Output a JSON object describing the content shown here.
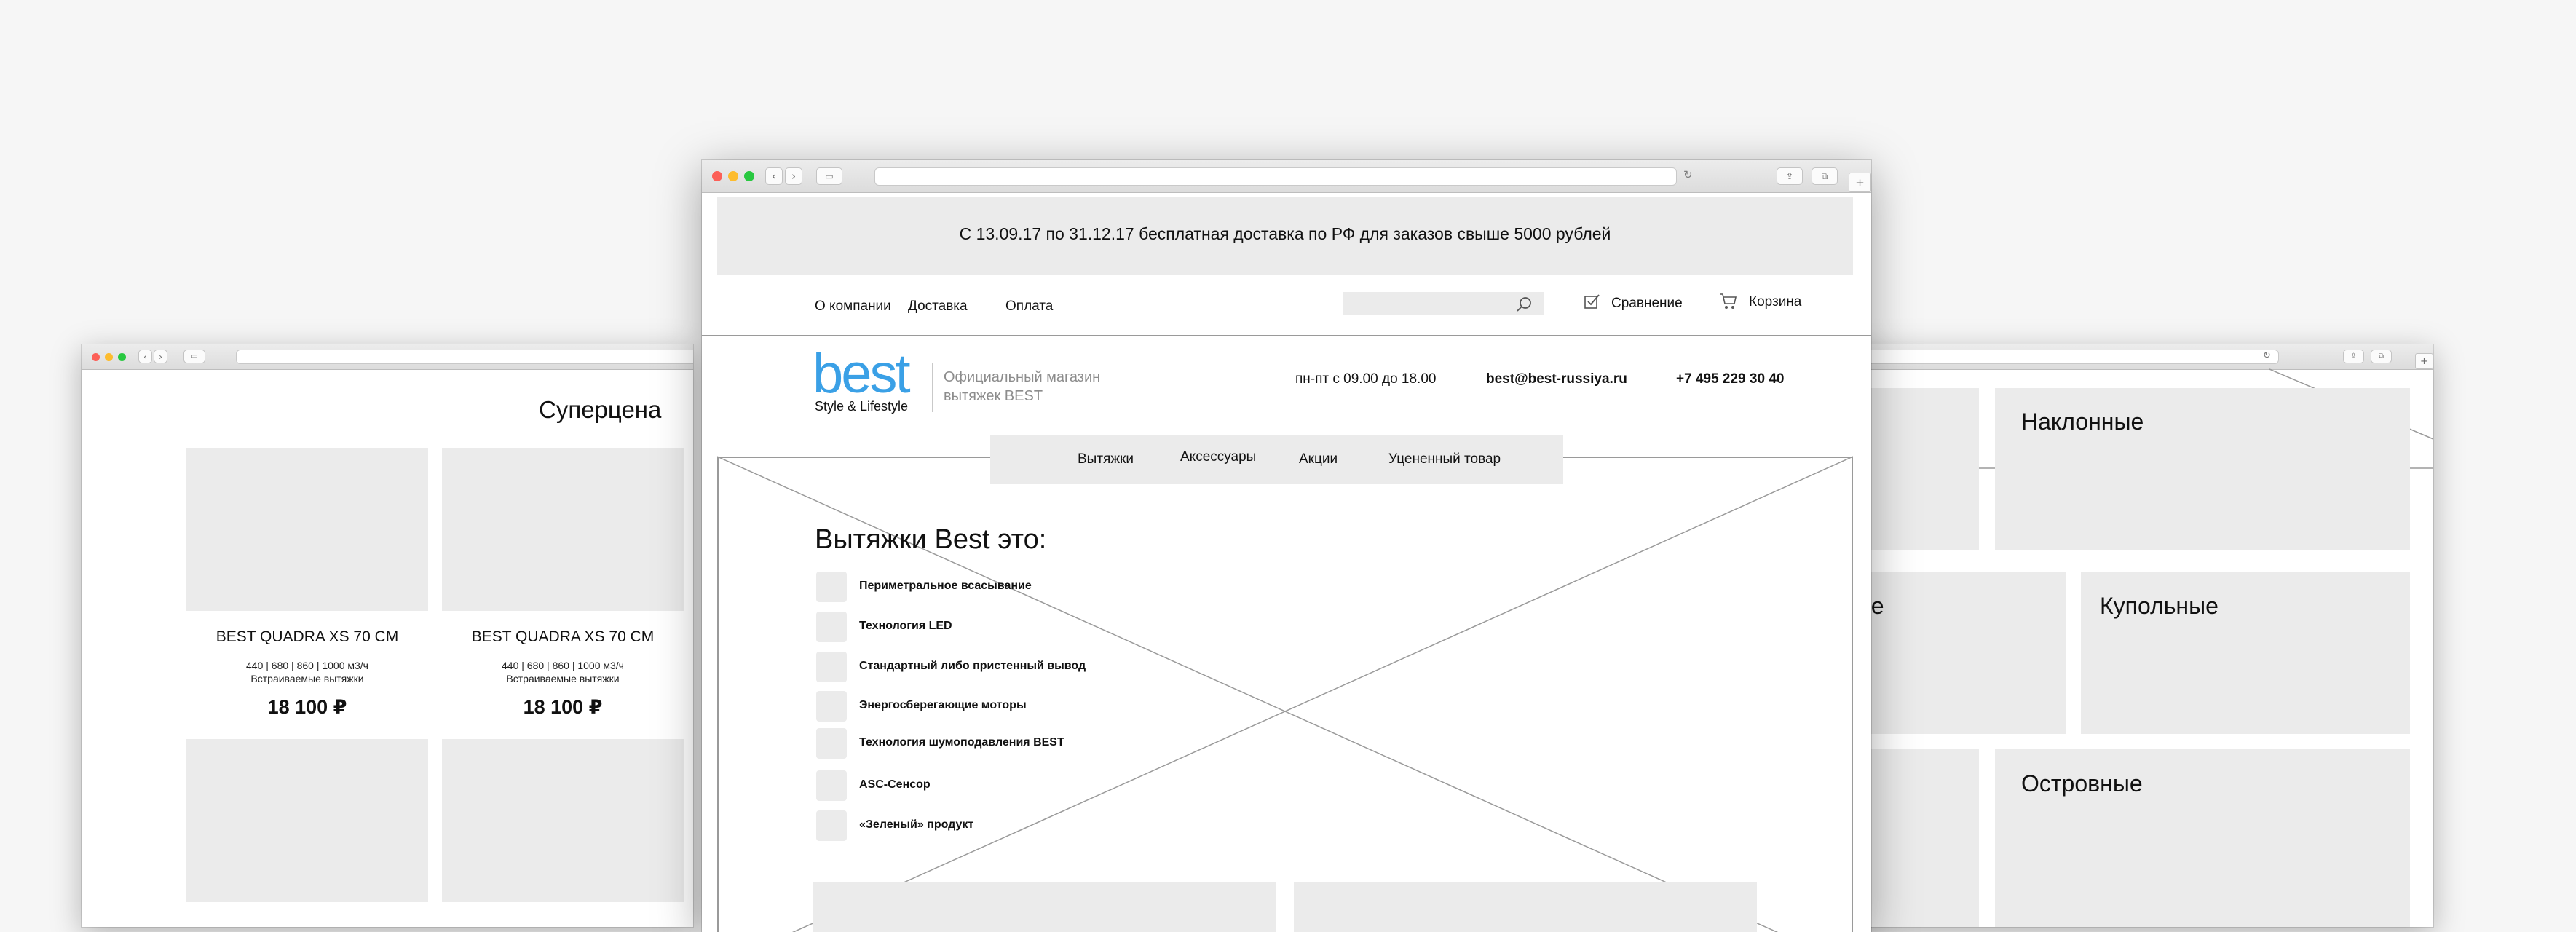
{
  "left_window": {
    "section_title": "Суперцена",
    "products": [
      {
        "name": "BEST QUADRA XS 70 CM",
        "specs": "440 | 680 | 860 | 1000 м3/ч",
        "category": "Встраиваемые вытяжки",
        "price": "18 100 ₽"
      },
      {
        "name": "BEST QUADRA XS 70 CM",
        "specs": "440 | 680 | 860 | 1000 м3/ч",
        "category": "Встраиваемые вытяжки",
        "price": "18 100 ₽"
      }
    ]
  },
  "right_window": {
    "categories": [
      {
        "label": "Наклонные"
      },
      {
        "label": "…овые"
      },
      {
        "label": "Купольные"
      },
      {
        "label": "Островные"
      }
    ]
  },
  "main_window": {
    "banner": "С 13.09.17 по 31.12.17 бесплатная доставка по РФ для заказов свыше 5000 рублей",
    "top_nav": [
      {
        "label": "О компании"
      },
      {
        "label": "Доставка"
      },
      {
        "label": "Оплата"
      }
    ],
    "search_placeholder": "",
    "compare_label": "Сравнение",
    "cart_label": "Корзина",
    "logo": {
      "word": "best",
      "tagline": "Style & Lifestyle",
      "color": "#3aa0e6"
    },
    "shop_desc": {
      "line1": "Официальный магазин",
      "line2": "вытяжек BEST"
    },
    "hours": "пн-пт с 09.00 до 18.00",
    "email": "best@best-russiya.ru",
    "phone": "+7 495 229 30 40",
    "main_menu": [
      {
        "label": "Вытяжки"
      },
      {
        "label": "Аксессуары"
      },
      {
        "label": "Акции"
      },
      {
        "label": "Уцененный товар"
      }
    ],
    "hero_title": "Вытяжки Best это:",
    "features": [
      {
        "label": "Периметральное всасывание"
      },
      {
        "label": "Технология LED"
      },
      {
        "label": "Стандартный либо пристенный вывод"
      },
      {
        "label": "Энергосберегающие моторы"
      },
      {
        "label": "Технология шумоподавления BEST"
      },
      {
        "label": "ASC-Сенсор"
      },
      {
        "label": "«Зеленый» продукт"
      }
    ]
  }
}
